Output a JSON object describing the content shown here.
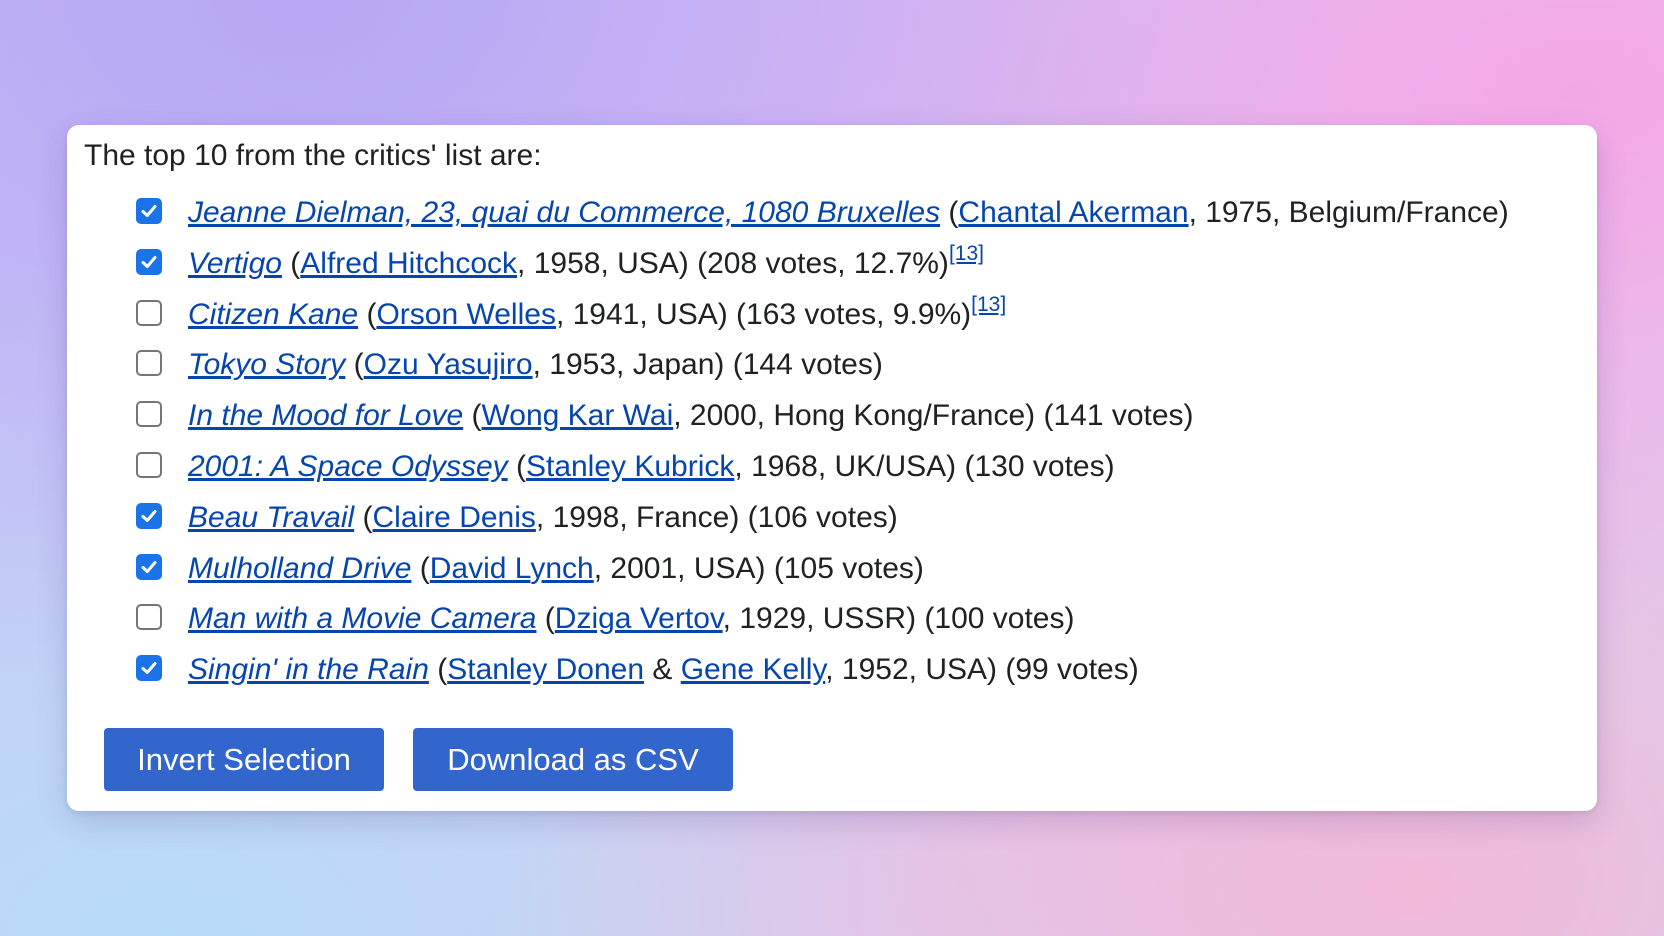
{
  "intro": "The top 10 from the critics' list are:",
  "items": [
    {
      "checked": true,
      "title": "Jeanne Dielman, 23, quai du Commerce, 1080 Bruxelles",
      "sep1": " (",
      "director": "Chantal Akerman",
      "amp": "",
      "director2": "",
      "info": ", 1975, Belgium/France)",
      "ref": ""
    },
    {
      "checked": true,
      "title": "Vertigo",
      "sep1": " (",
      "director": "Alfred Hitchcock",
      "amp": "",
      "director2": "",
      "info": ", 1958, USA) (208 votes, 12.7%)",
      "ref": "[13]"
    },
    {
      "checked": false,
      "title": "Citizen Kane",
      "sep1": " (",
      "director": "Orson Welles",
      "amp": "",
      "director2": "",
      "info": ", 1941, USA) (163 votes, 9.9%)",
      "ref": "[13]"
    },
    {
      "checked": false,
      "title": "Tokyo Story",
      "sep1": " (",
      "director": "Ozu Yasujiro",
      "amp": "",
      "director2": "",
      "info": ", 1953, Japan) (144 votes)",
      "ref": ""
    },
    {
      "checked": false,
      "title": "In the Mood for Love",
      "sep1": " (",
      "director": "Wong Kar Wai",
      "amp": "",
      "director2": "",
      "info": ", 2000, Hong Kong/France) (141 votes)",
      "ref": ""
    },
    {
      "checked": false,
      "title": "2001: A Space Odyssey",
      "sep1": " (",
      "director": "Stanley Kubrick",
      "amp": "",
      "director2": "",
      "info": ", 1968, UK/USA) (130 votes)",
      "ref": ""
    },
    {
      "checked": true,
      "title": "Beau Travail",
      "sep1": " (",
      "director": "Claire Denis",
      "amp": "",
      "director2": "",
      "info": ", 1998, France) (106 votes)",
      "ref": ""
    },
    {
      "checked": true,
      "title": "Mulholland Drive",
      "sep1": " (",
      "director": "David Lynch",
      "amp": "",
      "director2": "",
      "info": ", 2001, USA) (105 votes)",
      "ref": ""
    },
    {
      "checked": false,
      "title": "Man with a Movie Camera",
      "sep1": " (",
      "director": "Dziga Vertov",
      "amp": "",
      "director2": "",
      "info": ", 1929, USSR) (100 votes)",
      "ref": ""
    },
    {
      "checked": true,
      "title": "Singin' in the Rain",
      "sep1": " (",
      "director": "Stanley Donen",
      "amp": " & ",
      "director2": "Gene Kelly",
      "info": ", 1952, USA) (99 votes)",
      "ref": ""
    }
  ],
  "buttons": {
    "invert": "Invert Selection",
    "download": "Download as CSV"
  },
  "colors": {
    "link": "#0645ad",
    "button": "#3366cc",
    "checkbox_checked": "#1a73e8"
  }
}
